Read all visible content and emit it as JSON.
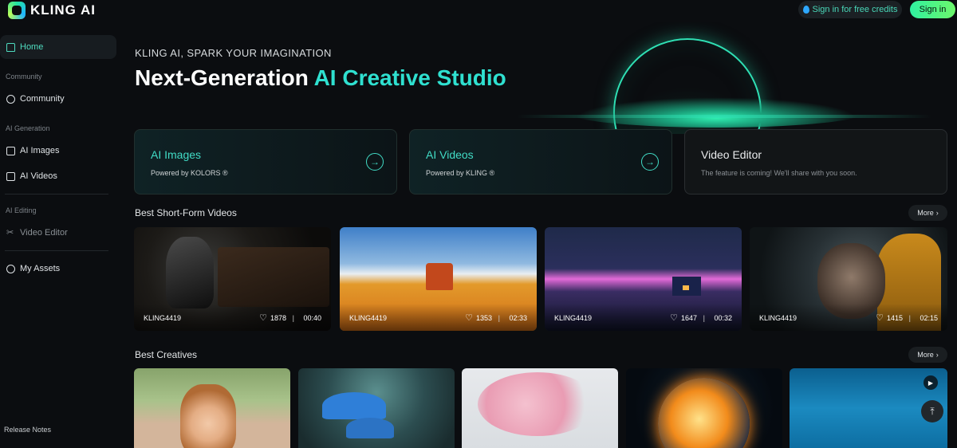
{
  "header": {
    "logo_text": "KLING AI",
    "credits_label": "Sign in for free credits",
    "signin_label": "Sign in"
  },
  "sidebar": {
    "home": "Home",
    "community_section": "Community",
    "community": "Community",
    "ai_generation_section": "AI Generation",
    "ai_images": "AI Images",
    "ai_videos": "AI Videos",
    "ai_editing_section": "AI Editing",
    "video_editor": "Video Editor",
    "my_assets": "My Assets",
    "release_notes": "Release Notes"
  },
  "hero": {
    "subtitle": "KLING AI, SPARK YOUR IMAGINATION",
    "title_main": "Next-Generation ",
    "title_accent": "AI Creative Studio"
  },
  "features": [
    {
      "title": "AI Images",
      "desc": "Powered by KOLORS ®",
      "arrow": "→"
    },
    {
      "title": "AI Videos",
      "desc": "Powered by KLING ®",
      "arrow": "→"
    },
    {
      "title": "Video Editor",
      "desc": "The feature is coming! We'll share with you soon."
    }
  ],
  "short_videos": {
    "heading": "Best Short-Form Videos",
    "more_label": "More",
    "items": [
      {
        "author": "KLING4419",
        "likes": "1878",
        "duration": "00:40"
      },
      {
        "author": "KLING4419",
        "likes": "1353",
        "duration": "02:33"
      },
      {
        "author": "KLING4419",
        "likes": "1647",
        "duration": "00:32"
      },
      {
        "author": "KLING4419",
        "likes": "1415",
        "duration": "02:15"
      }
    ]
  },
  "creatives": {
    "heading": "Best Creatives",
    "more_label": "More"
  },
  "colors": {
    "accent": "#2fe0d0",
    "background": "#0b0d10",
    "signin_gradient_start": "#2ff0a0"
  },
  "icons": {
    "heart": "♡",
    "chevron": "›",
    "play": "▶",
    "back_to_top": "⤒"
  }
}
